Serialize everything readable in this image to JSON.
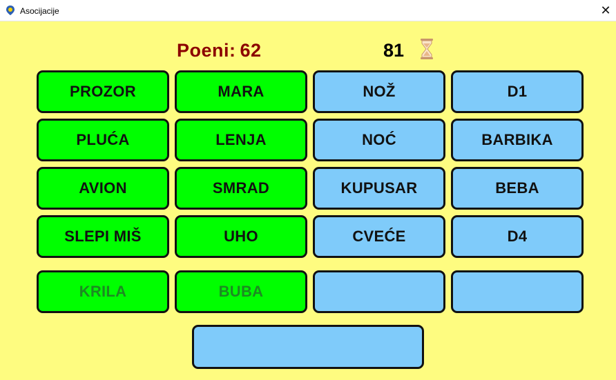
{
  "window": {
    "title": "Asocijacije",
    "close_glyph": "✕"
  },
  "header": {
    "score_label": "Poeni:",
    "score_value": "62",
    "timer_value": "81",
    "timer_icon": "hourglass-icon"
  },
  "columns": [
    {
      "id": "A",
      "state": "solved",
      "color": "#00ff00",
      "clues": [
        "PROZOR",
        "PLUĆA",
        "AVION",
        "SLEPI MIŠ"
      ],
      "solution": "KRILA"
    },
    {
      "id": "B",
      "state": "solved",
      "color": "#00ff00",
      "clues": [
        "MARA",
        "LENJA",
        "SMRAD",
        "UHO"
      ],
      "solution": "BUBA"
    },
    {
      "id": "C",
      "state": "open",
      "color": "#7fcbfa",
      "clues": [
        "NOŽ",
        "NOĆ",
        "KUPUSAR",
        "CVEĆE"
      ],
      "solution": ""
    },
    {
      "id": "D",
      "state": "open",
      "color": "#7fcbfa",
      "clues": [
        "D1",
        "BARBIKA",
        "BEBA",
        "D4"
      ],
      "solution": ""
    }
  ],
  "final_solution": ""
}
